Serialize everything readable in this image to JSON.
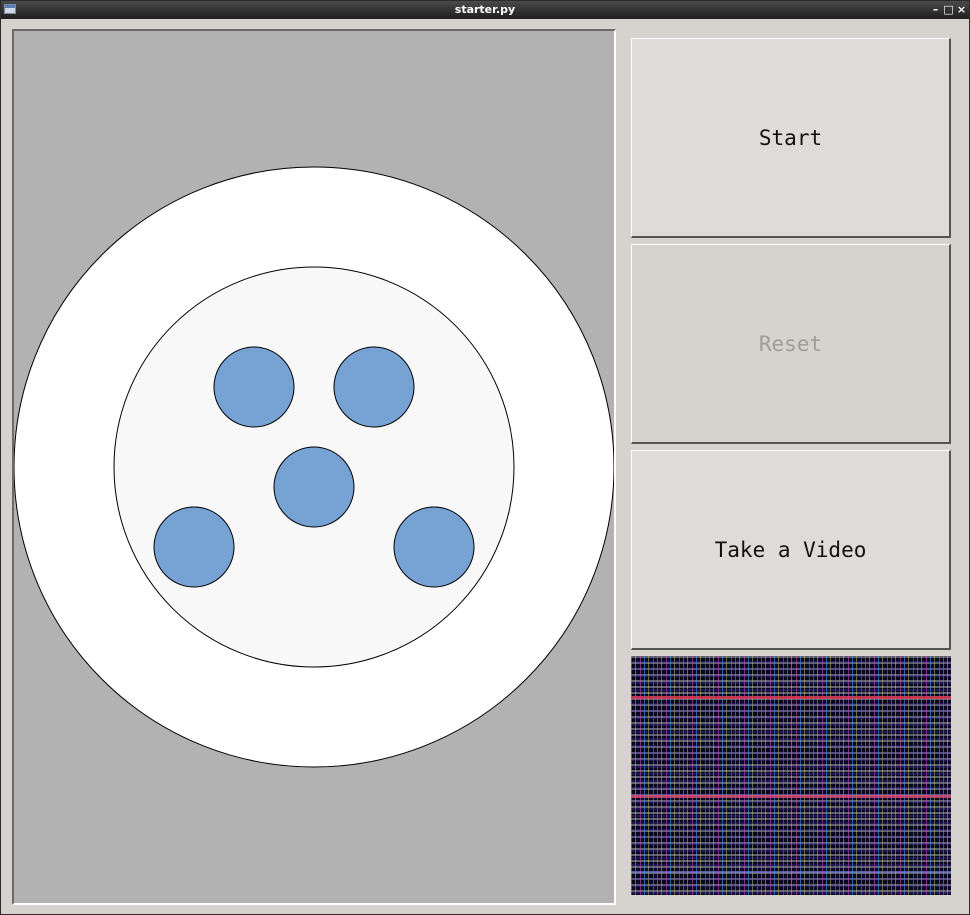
{
  "window": {
    "title": "starter.py",
    "controls": {
      "minimize_glyph": "–",
      "maximize_glyph": "□",
      "close_glyph": "×"
    }
  },
  "buttons": {
    "start_label": "Start",
    "reset_label": "Reset",
    "reset_enabled": false,
    "video_label": "Take a Video"
  },
  "canvas": {
    "background_color": "#b2b2b2",
    "outer_plate_color": "#ffffff",
    "inner_plate_color": "#f8f8f8",
    "marker_color": "#76a2d4",
    "marker_count": 5
  },
  "video_preview": {
    "content": "noise-static"
  }
}
